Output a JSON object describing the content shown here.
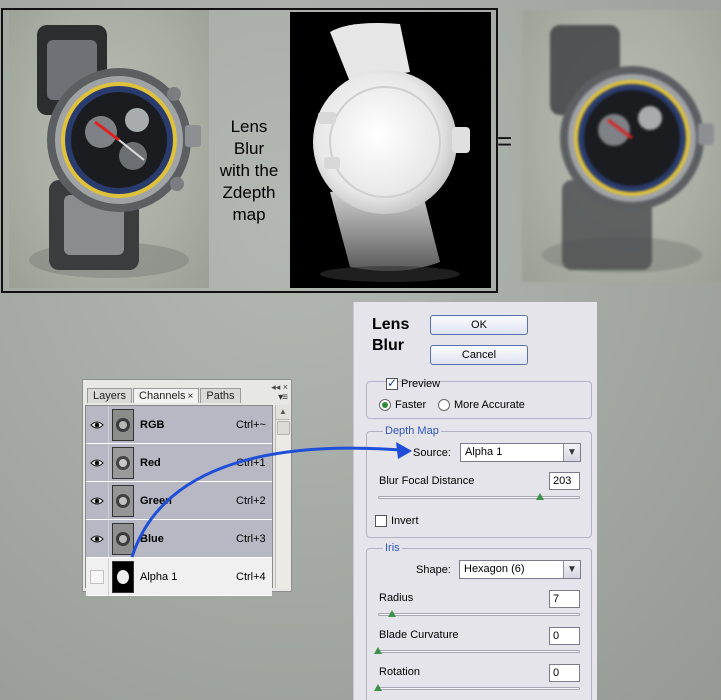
{
  "illustration": {
    "caption_lines": [
      "Lens",
      "Blur",
      "with the",
      "Zdepth",
      "map"
    ],
    "equals": "="
  },
  "channels_panel": {
    "tabs": [
      {
        "label": "Layers",
        "active": false,
        "close": ""
      },
      {
        "label": "Channels",
        "active": true,
        "close": "×"
      },
      {
        "label": "Paths",
        "active": false,
        "close": ""
      }
    ],
    "top_buttons": "◂◂ ×",
    "menu_icon": "▾≡",
    "channels": [
      {
        "name": "RGB",
        "shortcut": "Ctrl+~",
        "visible": true
      },
      {
        "name": "Red",
        "shortcut": "Ctrl+1",
        "visible": true
      },
      {
        "name": "Green",
        "shortcut": "Ctrl+2",
        "visible": true
      },
      {
        "name": "Blue",
        "shortcut": "Ctrl+3",
        "visible": true
      },
      {
        "name": "Alpha 1",
        "shortcut": "Ctrl+4",
        "visible": false
      }
    ]
  },
  "dialog": {
    "title": "Lens\nBlur",
    "ok_label": "OK",
    "cancel_label": "Cancel",
    "preview_label": "Preview",
    "preview_checked": true,
    "faster_label": "Faster",
    "more_accurate_label": "More Accurate",
    "quality_selected": "Faster",
    "depth_map": {
      "group_label": "Depth Map",
      "source_label": "Source:",
      "source_value": "Alpha 1",
      "focal_label": "Blur Focal Distance",
      "focal_value": "203",
      "focal_fraction": 0.8,
      "invert_label": "Invert",
      "invert_checked": false
    },
    "iris": {
      "group_label": "Iris",
      "shape_label": "Shape:",
      "shape_value": "Hexagon (6)",
      "radius_label": "Radius",
      "radius_value": "7",
      "radius_fraction": 0.07,
      "blade_label": "Blade Curvature",
      "blade_value": "0",
      "blade_fraction": 0.0,
      "rotation_label": "Rotation",
      "rotation_value": "0",
      "rotation_fraction": 0.0
    }
  },
  "colors": {
    "arrow": "#1f4fd8",
    "group_label": "#2f55c0",
    "slider_thumb": "#3e8f49"
  }
}
